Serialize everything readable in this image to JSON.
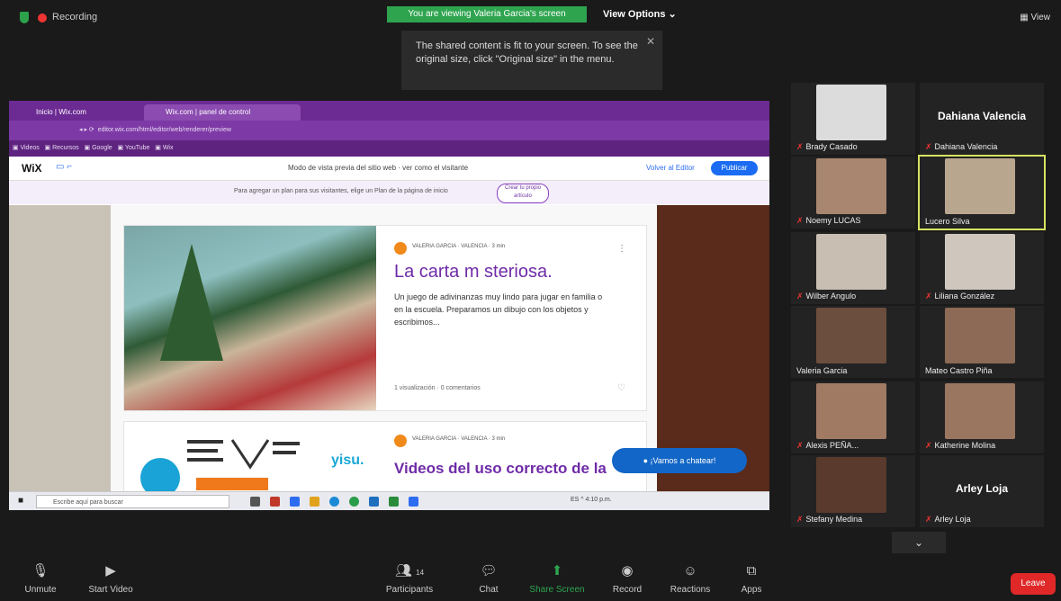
{
  "top_bar": {
    "recording": "Recording",
    "share_banner": "You are viewing Valeria Garcia's screen",
    "view_options": "View Options",
    "view": "View"
  },
  "tooltip": {
    "text": "The shared content is fit to your screen. To see the original size, click \"Original size\" in the menu.",
    "close": "✕"
  },
  "shared_screen": {
    "tabs": [
      "Inicio | Wix.com",
      "Wix.com | panel de control"
    ],
    "wix": {
      "logo": "WiX",
      "notice": "Modo de vista previa del sitio web · ver como el visitante",
      "link": "Volver al Editor",
      "button": "Publicar"
    },
    "strip": {
      "text": "Para agregar un plan para sus visitantes, elige un Plan de la página de inicio",
      "button": "Crear tu propio artículo"
    },
    "post1": {
      "meta": "VALERIA GARCIA · VALENCIA · 3 min",
      "title": "La carta m steriosa.",
      "excerpt": "Un juego de adivinanzas muy lindo para jugar en familia o en la escuela. Preparamos un dibujo con los objetos y escribimos...",
      "stats": "1 visualización · 0 comentarios",
      "menu": "⋮",
      "heart": "♡"
    },
    "post2": {
      "meta": "VALERIA GARCIA · VALENCIA · 3 min",
      "title": "Videos del uso correcto de la",
      "logo_text": "yisu."
    },
    "chat_button": "¡Vamos a chatear!",
    "taskbar": {
      "search": "Escribe aquí para buscar",
      "tray": "ES ^ 4:10 p.m."
    }
  },
  "participants": [
    {
      "name": "Brady Casado",
      "big": ""
    },
    {
      "name": "Dahiana Valencia",
      "big": "Dahiana Valencia"
    },
    {
      "name": "Noemy LUCAS",
      "big": ""
    },
    {
      "name": "Lucero Silva",
      "big": ""
    },
    {
      "name": "Wilber Angulo",
      "big": ""
    },
    {
      "name": "Liliana González",
      "big": ""
    },
    {
      "name": "Valeria Garcia",
      "big": ""
    },
    {
      "name": "Mateo Castro Piña",
      "big": ""
    },
    {
      "name": "Alexis PEÑA...",
      "big": ""
    },
    {
      "name": "Katherine Molina",
      "big": ""
    },
    {
      "name": "Stefany Medina",
      "big": ""
    },
    {
      "name": "Arley Loja",
      "big": "Arley Loja"
    }
  ],
  "tiles_more": "⌄",
  "toolbar": {
    "unmute": "Unmute",
    "start_video": "Start Video",
    "participants": "Participants",
    "participants_count": "14",
    "chat": "Chat",
    "share_screen": "Share Screen",
    "record": "Record",
    "reactions": "Reactions",
    "apps": "Apps",
    "leave": "Leave"
  },
  "colors": {
    "share_green": "#2ea44f",
    "leave_red": "#e02828",
    "browser_purple": "#6c2a93",
    "active_speaker": "#d7e361"
  }
}
